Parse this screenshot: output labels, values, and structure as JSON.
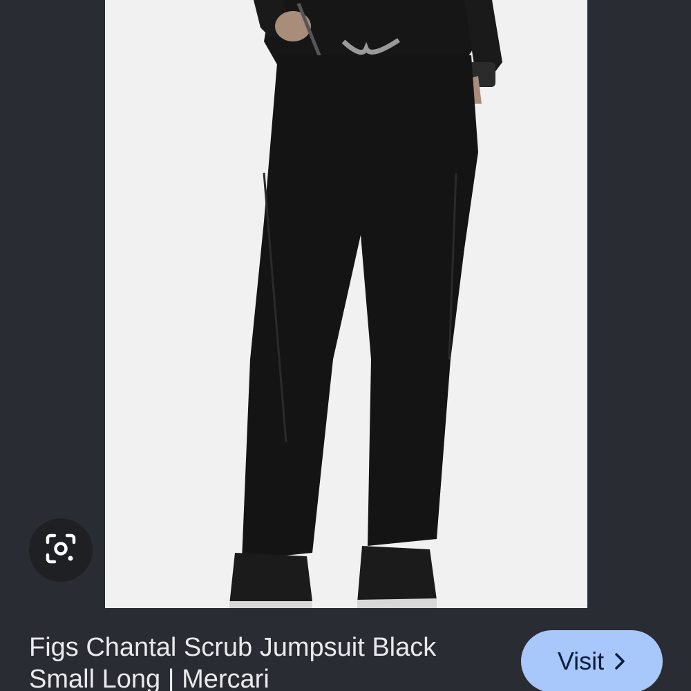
{
  "result": {
    "title": "Figs Chantal Scrub Jumpsuit Black Small Long | Mercari"
  },
  "actions": {
    "visit_label": "Visit",
    "visit_icon": "chevron-right-icon",
    "lens_icon": "google-lens-icon"
  },
  "colors": {
    "background": "#2a2c33",
    "image_background": "#f1f1f1",
    "visit_button": "#a8c7fa",
    "title_text": "#e8eaed"
  }
}
